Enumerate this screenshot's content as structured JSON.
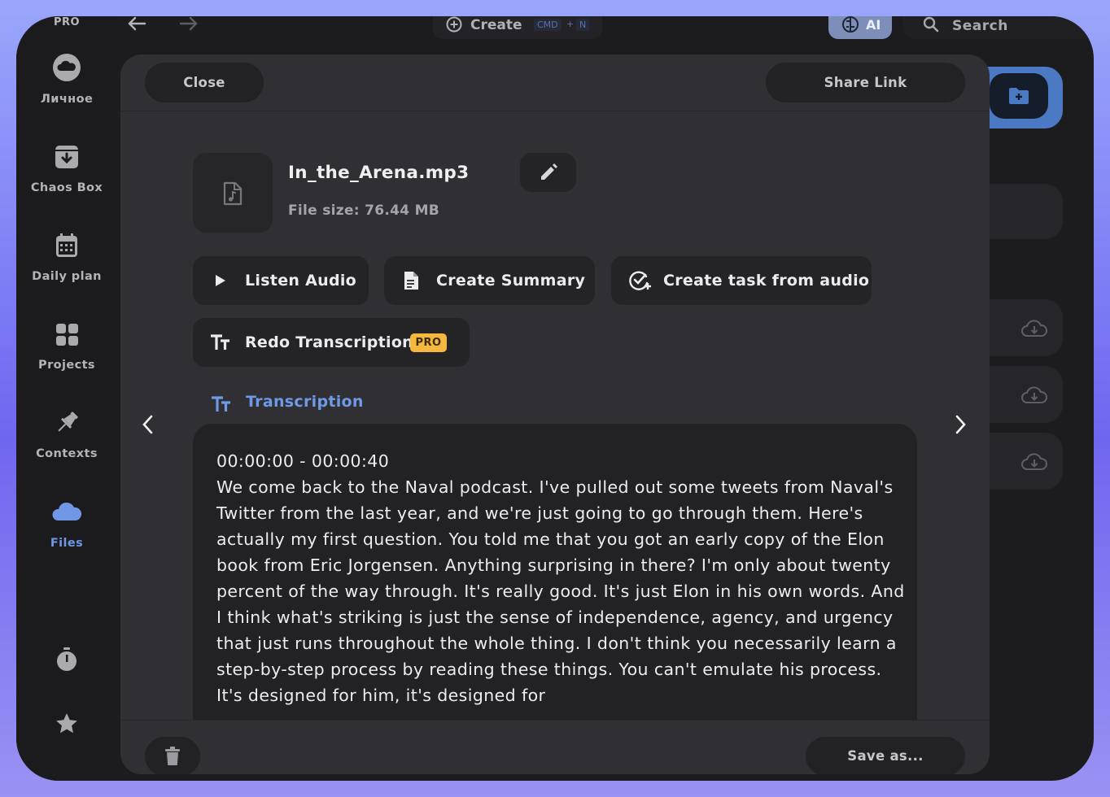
{
  "colors": {
    "accent_blue": "#6f97e6",
    "pro_badge": "#f5b83f",
    "modal_bg": "#303034",
    "frame_gradient_top": "#9aa7fb",
    "frame_gradient_mid": "#6f66f0"
  },
  "topbar": {
    "pro_label": "PRO",
    "back_icon": "arrow-left-icon",
    "forward_icon": "arrow-right-icon",
    "create_label": "Create",
    "create_shortcut_cmd": "CMD",
    "create_shortcut_plus": "+",
    "create_shortcut_key": "N",
    "ai_label": "AI",
    "search_label": "Search"
  },
  "sidebar": {
    "items": [
      {
        "label": "Личное",
        "icon": "cloud-icon"
      },
      {
        "label": "Chaos Box",
        "icon": "archive-box-icon"
      },
      {
        "label": "Daily plan",
        "icon": "calendar-icon"
      },
      {
        "label": "Projects",
        "icon": "grid-icon"
      },
      {
        "label": "Contexts",
        "icon": "pin-icon"
      },
      {
        "label": "Files",
        "icon": "cloud-icon",
        "active": true
      }
    ],
    "bottom_icons": [
      "timer-icon",
      "star-icon"
    ]
  },
  "modal": {
    "close_label": "Close",
    "share_label": "Share Link",
    "file": {
      "name": "In_the_Arena.mp3",
      "size": "File size: 76.44 MB",
      "icon": "audio-file-icon"
    },
    "actions": {
      "listen": "Listen Audio",
      "summary": "Create Summary",
      "task": "Create task from audio",
      "redo": "Redo Transcription",
      "redo_badge": "PRO"
    },
    "transcription": {
      "heading": "Transcription",
      "timestamp": "00:00:00 - 00:00:40",
      "text": "We come back to the Naval podcast. I've pulled out some tweets from Naval's Twitter from the last year, and we're just going to go through them. Here's actually my first question. You told me that you got an early copy of the Elon book from Eric Jorgensen. Anything surprising in there? I'm only about twenty percent of the way through. It's really good. It's just Elon in his own words. And I think what's striking is just the sense of independence, agency, and urgency that just runs throughout the whole thing. I don't think you necessarily learn a step-by-step process by reading these things. You can't emulate his process. It's designed for him, it's designed for"
    },
    "save_label": "Save as..."
  }
}
